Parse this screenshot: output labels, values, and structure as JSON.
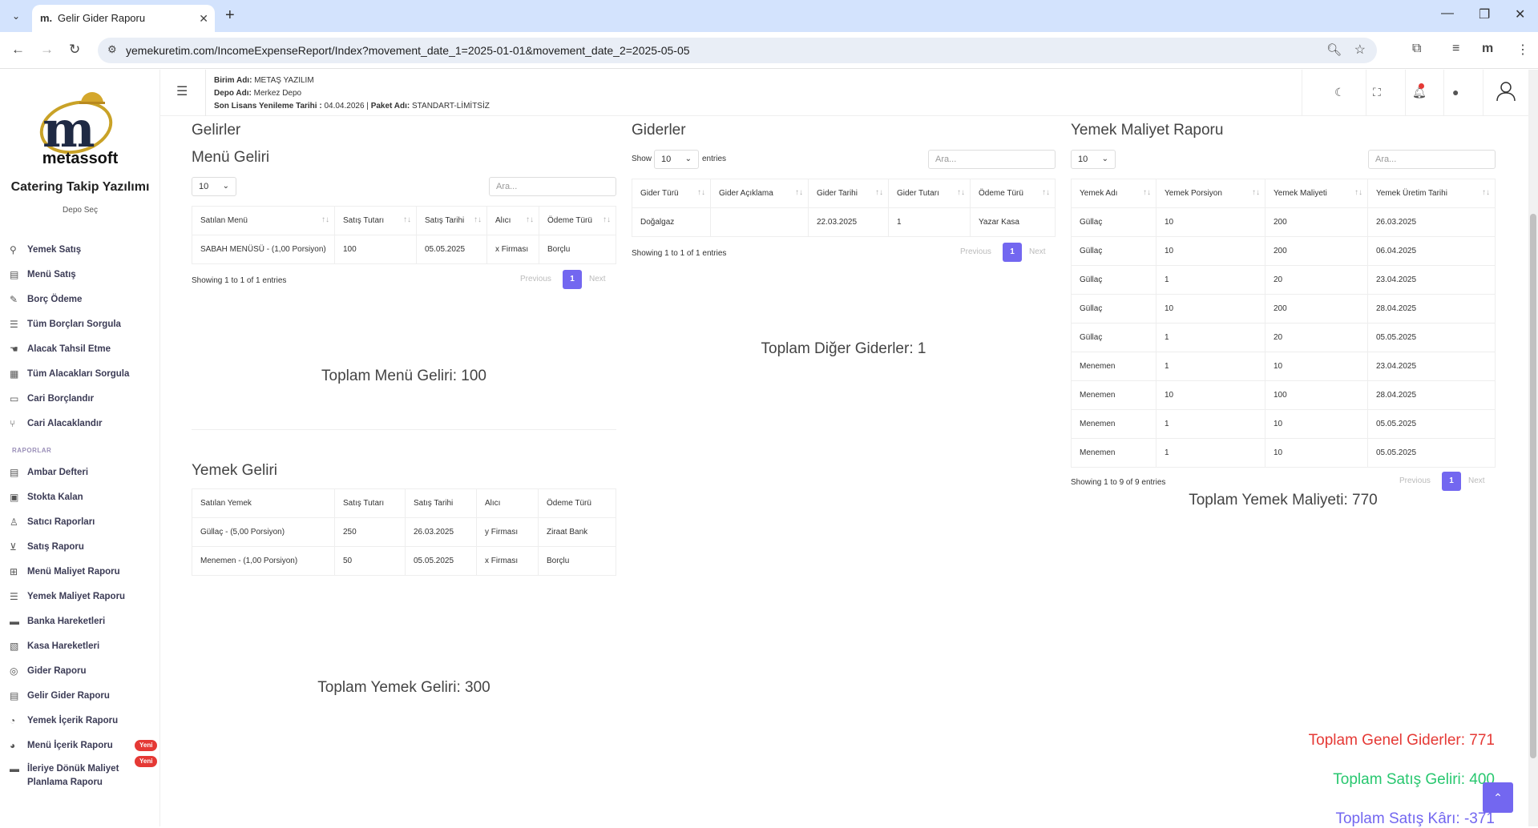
{
  "browser": {
    "tab_title": "Gelir Gider Raporu",
    "tab_favicon": "m.",
    "url": "yemekuretim.com/IncomeExpenseReport/Index?movement_date_1=2025-01-01&movement_date_2=2025-05-05"
  },
  "sidebar": {
    "brand": "metassoft",
    "app_title": "Catering Takip Yazılımı",
    "depo_select": "Depo Seç",
    "section_reports": "RAPORLAR",
    "items_top": [
      {
        "label": "Yemek Satış",
        "icon": "link-icon"
      },
      {
        "label": "Menü Satış",
        "icon": "menu-book-icon"
      },
      {
        "label": "Borç Ödeme",
        "icon": "pen-icon"
      },
      {
        "label": "Tüm Borçları Sorgula",
        "icon": "list-icon"
      },
      {
        "label": "Alacak Tahsil Etme",
        "icon": "hand-icon"
      },
      {
        "label": "Tüm Alacakları Sorgula",
        "icon": "calendar-icon"
      },
      {
        "label": "Cari Borçlandır",
        "icon": "cash-icon"
      },
      {
        "label": "Cari Alacaklandır",
        "icon": "split-icon"
      }
    ],
    "items_reports": [
      {
        "label": "Ambar Defteri",
        "icon": "book-icon"
      },
      {
        "label": "Stokta Kalan",
        "icon": "box-icon"
      },
      {
        "label": "Satıcı Raporları",
        "icon": "user-icon"
      },
      {
        "label": "Satış Raporu",
        "icon": "cart-icon"
      },
      {
        "label": "Menü Maliyet Raporu",
        "icon": "grid-icon"
      },
      {
        "label": "Yemek Maliyet Raporu",
        "icon": "list-icon"
      },
      {
        "label": "Banka Hareketleri",
        "icon": "bank-icon"
      },
      {
        "label": "Kasa Hareketleri",
        "icon": "register-icon"
      },
      {
        "label": "Gider Raporu",
        "icon": "coins-icon"
      },
      {
        "label": "Gelir Gider Raporu",
        "icon": "doc-icon"
      },
      {
        "label": "Yemek İçerik Raporu",
        "icon": "chart-icon"
      },
      {
        "label": "Menü İçerik Raporu",
        "icon": "pie-icon",
        "badge": "Yeni"
      },
      {
        "label": "İleriye Dönük Maliyet Planlama Raporu",
        "icon": "planning-icon",
        "badge": "Yeni"
      }
    ]
  },
  "topbar": {
    "birim_label": "Birim Adı:",
    "birim_value": "METAŞ YAZILIM",
    "depo_label": "Depo Adı:",
    "depo_value": "Merkez Depo",
    "license_label": "Son Lisans Yenileme Tarihi :",
    "license_value": "04.04.2026 |",
    "paket_label": "Paket Adı:",
    "paket_value": "STANDART-LİMİTSİZ"
  },
  "gelirler": {
    "title": "Gelirler",
    "menu_geliri": {
      "title": "Menü Geliri",
      "length": "10",
      "search_placeholder": "Ara...",
      "columns": [
        "Satılan Menü",
        "Satış Tutarı",
        "Satış Tarihi",
        "Alıcı",
        "Ödeme Türü"
      ],
      "rows": [
        [
          "SABAH MENÜSÜ - (1,00 Porsiyon)",
          "100",
          "05.05.2025",
          "x Firması",
          "Borçlu"
        ]
      ],
      "info": "Showing 1 to 1 of 1 entries",
      "prev": "Previous",
      "page": "1",
      "next": "Next",
      "total": "Toplam Menü Geliri: 100"
    },
    "yemek_geliri": {
      "title": "Yemek Geliri",
      "columns": [
        "Satılan Yemek",
        "Satış Tutarı",
        "Satış Tarihi",
        "Alıcı",
        "Ödeme Türü"
      ],
      "rows": [
        [
          "Güllaç - (5,00 Porsiyon)",
          "250",
          "26.03.2025",
          "y Firması",
          "Ziraat Bank"
        ],
        [
          "Menemen - (1,00 Porsiyon)",
          "50",
          "05.05.2025",
          "x Firması",
          "Borçlu"
        ]
      ],
      "total": "Toplam Yemek Geliri: 300"
    }
  },
  "giderler": {
    "title": "Giderler",
    "show": "Show",
    "length": "10",
    "entries": "entries",
    "search_placeholder": "Ara...",
    "columns": [
      "Gider Türü",
      "Gider Açıklama",
      "Gider Tarihi",
      "Gider Tutarı",
      "Ödeme Türü"
    ],
    "rows": [
      [
        "Doğalgaz",
        "",
        "22.03.2025",
        "1",
        "Yazar Kasa"
      ]
    ],
    "info": "Showing 1 to 1 of 1 entries",
    "prev": "Previous",
    "page": "1",
    "next": "Next",
    "total": "Toplam Diğer Giderler: 1"
  },
  "yemek_maliyet": {
    "title": "Yemek Maliyet Raporu",
    "length": "10",
    "search_placeholder": "Ara...",
    "columns": [
      "Yemek Adı",
      "Yemek Porsiyon",
      "Yemek Maliyeti",
      "Yemek Üretim Tarihi"
    ],
    "rows": [
      [
        "Güllaç",
        "10",
        "200",
        "26.03.2025"
      ],
      [
        "Güllaç",
        "10",
        "200",
        "06.04.2025"
      ],
      [
        "Güllaç",
        "1",
        "20",
        "23.04.2025"
      ],
      [
        "Güllaç",
        "10",
        "200",
        "28.04.2025"
      ],
      [
        "Güllaç",
        "1",
        "20",
        "05.05.2025"
      ],
      [
        "Menemen",
        "1",
        "10",
        "23.04.2025"
      ],
      [
        "Menemen",
        "10",
        "100",
        "28.04.2025"
      ],
      [
        "Menemen",
        "1",
        "10",
        "05.05.2025"
      ],
      [
        "Menemen",
        "1",
        "10",
        "05.05.2025"
      ]
    ],
    "info": "Showing 1 to 9 of 9 entries",
    "prev": "Previous",
    "page": "1",
    "next": "Next",
    "total": "Toplam Yemek Maliyeti: 770"
  },
  "summary": {
    "genel_giderler": "Toplam Genel Giderler: 771",
    "satis_geliri": "Toplam Satış Geliri: 400",
    "satis_kari": "Toplam Satış Kârı: -371",
    "colors": {
      "giderler": "#e53935",
      "gelir": "#28c76f",
      "kar": "#7367f0"
    }
  }
}
